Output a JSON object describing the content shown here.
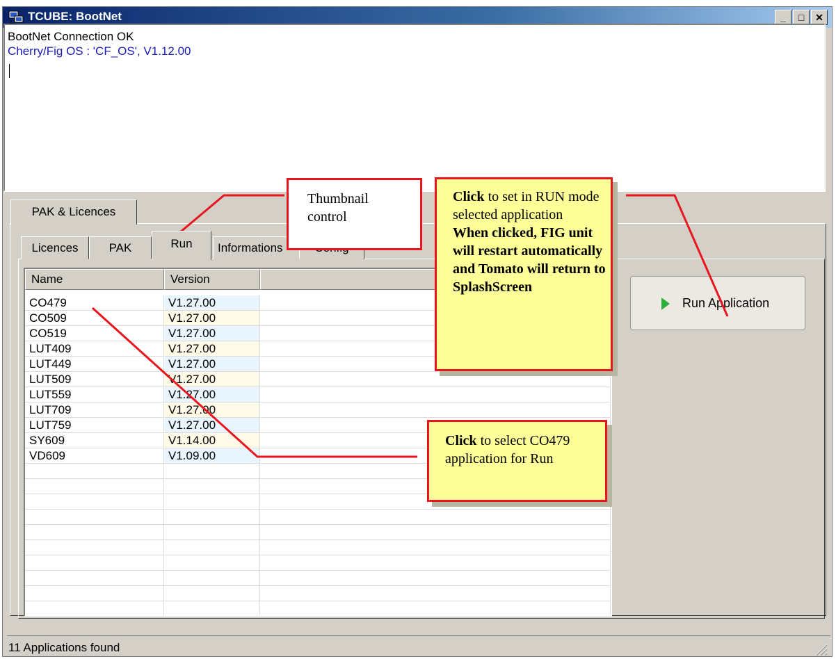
{
  "window": {
    "title": "TCUBE: BootNet",
    "minimize_label": "_",
    "maximize_label": "□",
    "close_label": "✕",
    "app_icon": "network-computer-icon"
  },
  "log": {
    "line1": "BootNet Connection OK",
    "line2": "Cherry/Fig OS : 'CF_OS', V1.12.00"
  },
  "outer_tabs": [
    {
      "label": "PAK & Licences"
    }
  ],
  "inner_tabs": [
    {
      "label": "Licences"
    },
    {
      "label": "PAK"
    },
    {
      "label": "Run",
      "selected": true
    },
    {
      "label": "Informations"
    },
    {
      "label": "Config"
    }
  ],
  "list": {
    "columns": [
      "Name",
      "Version"
    ],
    "rows": [
      {
        "name": "CO479",
        "version": "V1.27.00"
      },
      {
        "name": "CO509",
        "version": "V1.27.00"
      },
      {
        "name": "CO519",
        "version": "V1.27.00"
      },
      {
        "name": "LUT409",
        "version": "V1.27.00"
      },
      {
        "name": "LUT449",
        "version": "V1.27.00"
      },
      {
        "name": "LUT509",
        "version": "V1.27.00"
      },
      {
        "name": "LUT559",
        "version": "V1.27.00"
      },
      {
        "name": "LUT709",
        "version": "V1.27.00"
      },
      {
        "name": "LUT759",
        "version": "V1.27.00"
      },
      {
        "name": "SY609",
        "version": "V1.14.00"
      },
      {
        "name": "VD609",
        "version": "V1.09.00"
      }
    ]
  },
  "run_button": {
    "label": "Run Application",
    "icon": "play-arrow-icon"
  },
  "status": {
    "text": "11 Applications found"
  },
  "callouts": {
    "thumbnail": {
      "line1": "Thumbnail",
      "line2": "control"
    },
    "run": {
      "bold1": "Click",
      "text1": "to set in RUN mode selected application",
      "bold2": "When clicked, FIG unit will restart automatically and Tomato will return to SplashScreen"
    },
    "select": {
      "bold": "Click",
      "text": "to select CO479 application for Run"
    }
  },
  "colors": {
    "title_bar_start": "#0a246a",
    "title_bar_end": "#a6caf0",
    "callout_border": "#e8141e",
    "callout_fill": "#ffff99",
    "log_line2": "#1a1ab8",
    "play_icon": "#2fae3a"
  }
}
